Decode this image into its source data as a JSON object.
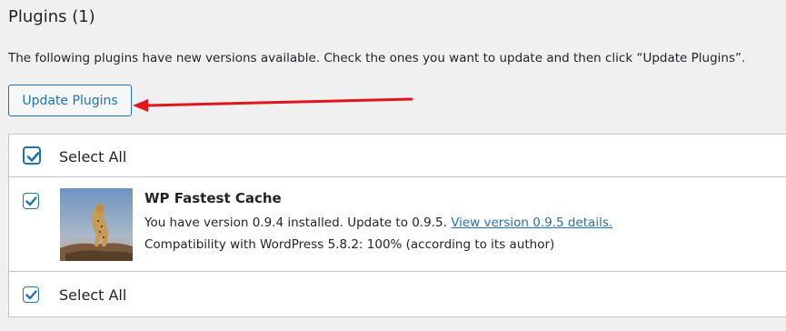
{
  "page": {
    "title": "Plugins (1)",
    "description": "The following plugins have new versions available. Check the ones you want to update and then click “Update Plugins”.",
    "update_button_label": "Update Plugins"
  },
  "table": {
    "select_all_header": "Select All",
    "select_all_footer": "Select All",
    "header_checked": true,
    "footer_checked": true
  },
  "plugins": [
    {
      "name": "WP Fastest Cache",
      "checked": true,
      "version_text": "You have version 0.9.4 installed. Update to 0.9.5. ",
      "details_link": "View version 0.9.5 details.",
      "compatibility": "Compatibility with WordPress 5.8.2: 100% (according to its author)"
    }
  ],
  "colors": {
    "accent": "#2271b1",
    "arrow": "#e0161c",
    "background": "#f0f0f1"
  }
}
